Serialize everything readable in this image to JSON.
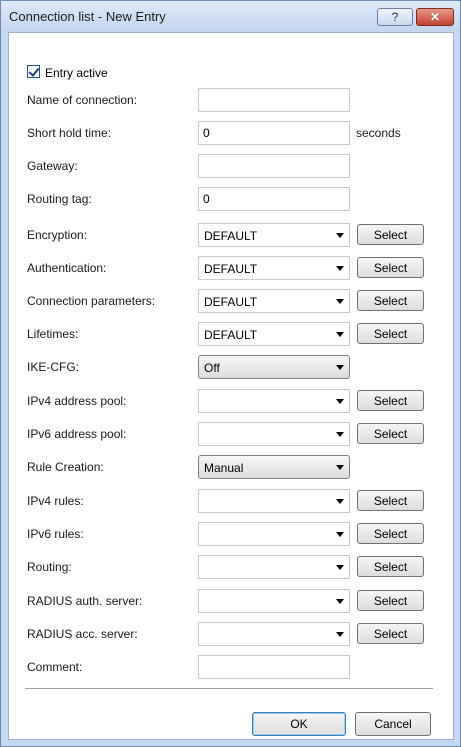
{
  "window": {
    "title": "Connection list - New Entry",
    "help_glyph": "?",
    "close_glyph": "✕"
  },
  "entry_active": {
    "label": "Entry active",
    "checked": true
  },
  "fields": {
    "name_of_connection": {
      "label": "Name of connection:",
      "value": ""
    },
    "short_hold_time": {
      "label": "Short hold time:",
      "value": "0",
      "unit": "seconds"
    },
    "gateway": {
      "label": "Gateway:",
      "value": ""
    },
    "routing_tag": {
      "label": "Routing tag:",
      "value": "0"
    },
    "encryption": {
      "label": "Encryption:",
      "value": "DEFAULT"
    },
    "authentication": {
      "label": "Authentication:",
      "value": "DEFAULT"
    },
    "connection_parameters": {
      "label": "Connection parameters:",
      "value": "DEFAULT"
    },
    "lifetimes": {
      "label": "Lifetimes:",
      "value": "DEFAULT"
    },
    "ike_cfg": {
      "label": "IKE-CFG:",
      "value": "Off"
    },
    "ipv4_address_pool": {
      "label": "IPv4 address pool:",
      "value": ""
    },
    "ipv6_address_pool": {
      "label": "IPv6 address pool:",
      "value": ""
    },
    "rule_creation": {
      "label": "Rule Creation:",
      "value": "Manual"
    },
    "ipv4_rules": {
      "label": "IPv4 rules:",
      "value": ""
    },
    "ipv6_rules": {
      "label": "IPv6 rules:",
      "value": ""
    },
    "routing": {
      "label": "Routing:",
      "value": ""
    },
    "radius_auth_server": {
      "label": "RADIUS auth. server:",
      "value": ""
    },
    "radius_acc_server": {
      "label": "RADIUS acc. server:",
      "value": ""
    },
    "comment": {
      "label": "Comment:",
      "value": ""
    }
  },
  "buttons": {
    "select": "Select",
    "ok": "OK",
    "cancel": "Cancel"
  }
}
